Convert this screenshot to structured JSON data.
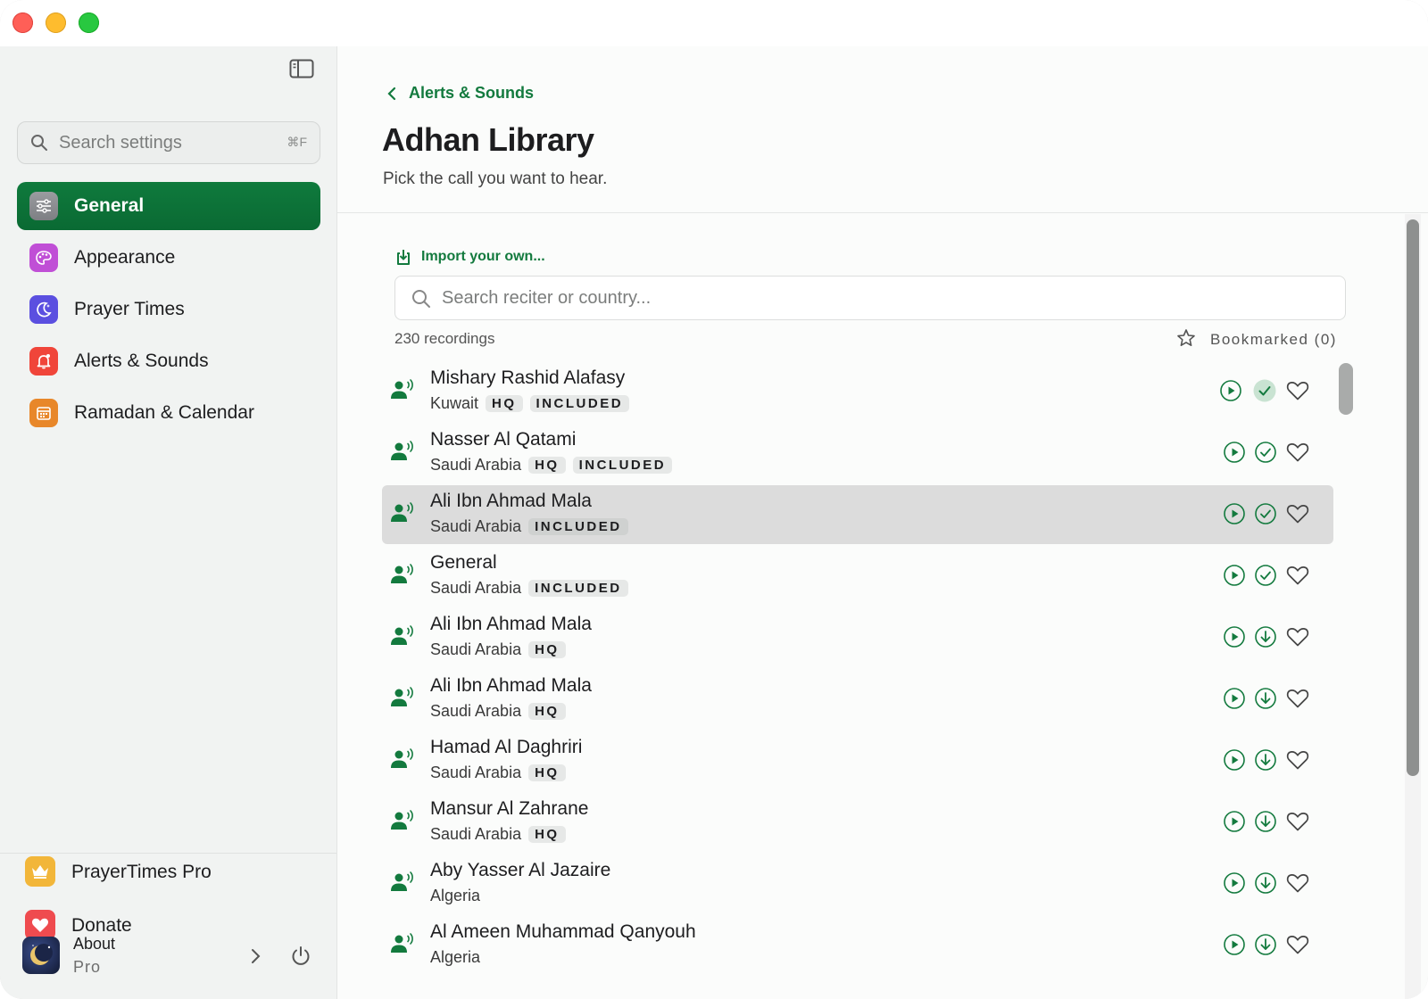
{
  "sidebar": {
    "search": {
      "placeholder": "Search settings",
      "shortcut": "⌘F"
    },
    "items": [
      {
        "label": "General",
        "icon": "sliders-icon",
        "color": "#8e8e93",
        "active": true
      },
      {
        "label": "Appearance",
        "icon": "palette-icon",
        "color": "#c04fd6"
      },
      {
        "label": "Prayer Times",
        "icon": "moon-icon",
        "color": "#5b4fe0"
      },
      {
        "label": "Alerts & Sounds",
        "icon": "bell-icon",
        "color": "#f0453a"
      },
      {
        "label": "Ramadan & Calendar",
        "icon": "calendar-icon",
        "color": "#e8872a"
      }
    ],
    "bottom": {
      "pro": {
        "label": "PrayerTimes Pro",
        "icon": "crown-icon",
        "color": "#f2b63a"
      },
      "donate": {
        "label": "Donate",
        "icon": "heart-icon",
        "color": "#ef4b4f"
      },
      "about": {
        "title": "About",
        "subtitle": "Pro"
      }
    }
  },
  "main": {
    "back_label": "Alerts & Sounds",
    "title": "Adhan Library",
    "subtitle": "Pick the call you want to hear.",
    "import_label": "Import your own...",
    "search_placeholder": "Search reciter or country...",
    "count": "230 recordings",
    "bookmarked": "Bookmarked (0)",
    "accent": "#137a3e",
    "rows": [
      {
        "name": "Mishary Rashid Alafasy",
        "country": "Kuwait",
        "badges": [
          "HQ",
          "INCLUDED"
        ],
        "status": "selected-check"
      },
      {
        "name": "Nasser Al Qatami",
        "country": "Saudi Arabia",
        "badges": [
          "HQ",
          "INCLUDED"
        ],
        "status": "check"
      },
      {
        "name": "Ali Ibn Ahmad Mala",
        "country": "Saudi Arabia",
        "badges": [
          "INCLUDED"
        ],
        "status": "check",
        "highlighted": true
      },
      {
        "name": "General",
        "country": "Saudi Arabia",
        "badges": [
          "INCLUDED"
        ],
        "status": "check"
      },
      {
        "name": "Ali Ibn Ahmad Mala",
        "country": "Saudi Arabia",
        "badges": [
          "HQ"
        ],
        "status": "download"
      },
      {
        "name": "Ali Ibn Ahmad Mala",
        "country": "Saudi Arabia",
        "badges": [
          "HQ"
        ],
        "status": "download"
      },
      {
        "name": "Hamad Al Daghriri",
        "country": "Saudi Arabia",
        "badges": [
          "HQ"
        ],
        "status": "download"
      },
      {
        "name": "Mansur Al Zahrane",
        "country": "Saudi Arabia",
        "badges": [
          "HQ"
        ],
        "status": "download"
      },
      {
        "name": "Aby Yasser Al Jazaire",
        "country": "Algeria",
        "badges": [],
        "status": "download"
      },
      {
        "name": "Al Ameen Muhammad Qanyouh",
        "country": "Algeria",
        "badges": [],
        "status": "download"
      }
    ]
  }
}
